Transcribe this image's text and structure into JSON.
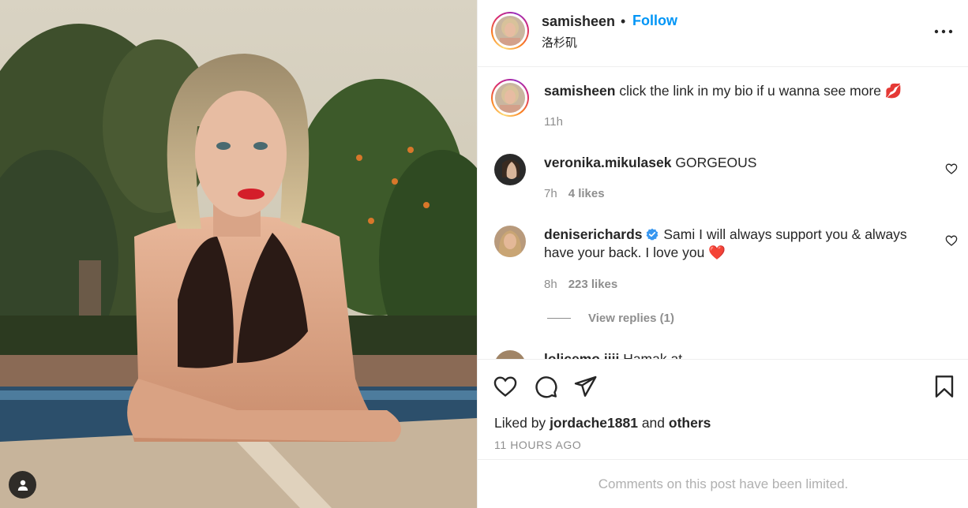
{
  "post": {
    "username": "samisheen",
    "follow_label": "Follow",
    "separator": "•",
    "location": "洛杉矶"
  },
  "caption": {
    "username": "samisheen",
    "text": "click the link in my bio if u wanna see more 💋",
    "time": "11h"
  },
  "comments": [
    {
      "username": "veronika.mikulasek",
      "text": "GORGEOUS",
      "time": "7h",
      "likes": "4 likes"
    },
    {
      "username": "deniserichards",
      "verified": true,
      "text": "Sami I will always support you & always have your back. I love you ❤️",
      "time": "8h",
      "likes": "223 likes",
      "replies_label": "View replies (1)"
    }
  ],
  "partial_comment": {
    "username": "lolicemo.iiii",
    "text": "Hamak at"
  },
  "likes_summary": {
    "prefix": "Liked by",
    "user": "jordache1881",
    "middle": "and",
    "others": "others"
  },
  "timestamp": "11 HOURS AGO",
  "limited_notice": "Comments on this post have been limited.",
  "icons": {
    "like": "heart-icon",
    "comment": "comment-bubble-icon",
    "share": "paper-plane-icon",
    "save": "bookmark-icon",
    "more": "ellipsis-icon",
    "verified": "verified-badge-icon",
    "user_tag": "user-icon"
  },
  "colors": {
    "accent": "#0095f6",
    "text": "#262626",
    "muted": "#8e8e8e",
    "verified": "#3897f0"
  }
}
